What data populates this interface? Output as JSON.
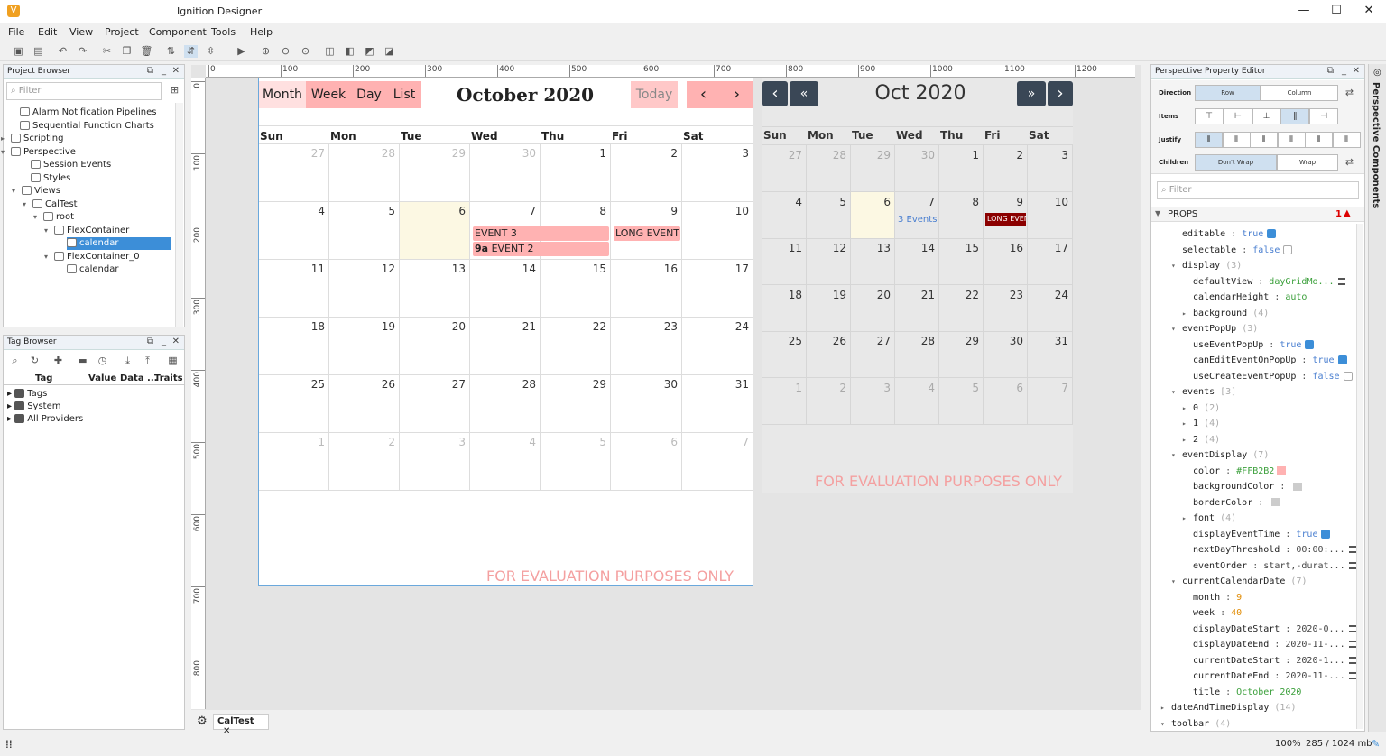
{
  "window": {
    "title": "Ignition Designer",
    "app_icon": "V",
    "minimize": "—",
    "maximize": "☐",
    "close": "✕"
  },
  "menu": [
    "File",
    "Edit",
    "View",
    "Project",
    "Component",
    "Tools",
    "Help"
  ],
  "project_browser": {
    "title": "Project Browser",
    "filter_placeholder": "Filter",
    "items": [
      {
        "label": "Alarm Notification Pipelines",
        "icon": "alarm-icon"
      },
      {
        "label": "Sequential Function Charts",
        "icon": "sfc-icon"
      },
      {
        "label": "Scripting",
        "icon": "script-icon"
      },
      {
        "label": "Perspective",
        "icon": "perspective-icon"
      },
      {
        "label": "Session Events",
        "icon": "session-icon"
      },
      {
        "label": "Styles",
        "icon": "styles-icon"
      },
      {
        "label": "Views",
        "icon": "views-icon"
      },
      {
        "label": "CalTest",
        "icon": "view-icon"
      },
      {
        "label": "root",
        "icon": "root-icon"
      },
      {
        "label": "FlexContainer",
        "icon": "flex-icon"
      },
      {
        "label": "calendar",
        "icon": "calendar-icon"
      },
      {
        "label": "FlexContainer_0",
        "icon": "flex-icon"
      },
      {
        "label": "calendar",
        "icon": "calendar-icon"
      }
    ]
  },
  "tag_browser": {
    "title": "Tag Browser",
    "columns": [
      "Tag",
      "Value",
      "Data ...",
      "Traits"
    ],
    "items": [
      "Tags",
      "System",
      "All Providers"
    ]
  },
  "ruler": {
    "h": [
      "0",
      "100",
      "200",
      "300",
      "400",
      "500",
      "600",
      "700",
      "800",
      "900",
      "1000",
      "1100",
      "1200"
    ],
    "v": [
      "0",
      "100",
      "200",
      "300",
      "400",
      "500",
      "600",
      "700",
      "800"
    ]
  },
  "calendar1": {
    "views": [
      "Month",
      "Week",
      "Day",
      "List"
    ],
    "title": "October 2020",
    "today": "Today",
    "prev": "‹",
    "next": "›",
    "dow": [
      "Sun",
      "Mon",
      "Tue",
      "Wed",
      "Thu",
      "Fri",
      "Sat"
    ],
    "days": [
      "27",
      "28",
      "29",
      "30",
      "1",
      "2",
      "3",
      "4",
      "5",
      "6",
      "7",
      "8",
      "9",
      "10",
      "11",
      "12",
      "13",
      "14",
      "15",
      "16",
      "17",
      "18",
      "19",
      "20",
      "21",
      "22",
      "23",
      "24",
      "25",
      "26",
      "27",
      "28",
      "29",
      "30",
      "31",
      "1",
      "2",
      "3",
      "4",
      "5",
      "6",
      "7"
    ],
    "events": {
      "event3": "EVENT 3",
      "event2_time": "9a",
      "event2": "EVENT 2",
      "long": "LONG EVENT N"
    },
    "watermark": "FOR EVALUATION PURPOSES ONLY",
    "event_color": "#FFB2B2"
  },
  "calendar2": {
    "prev": "‹",
    "prev_year": "«",
    "title": "Oct 2020",
    "next_year": "»",
    "next": "›",
    "dow": [
      "Sun",
      "Mon",
      "Tue",
      "Wed",
      "Thu",
      "Fri",
      "Sat"
    ],
    "days": [
      "27",
      "28",
      "29",
      "30",
      "1",
      "2",
      "3",
      "4",
      "5",
      "6",
      "7",
      "8",
      "9",
      "10",
      "11",
      "12",
      "13",
      "14",
      "15",
      "16",
      "17",
      "18",
      "19",
      "20",
      "21",
      "22",
      "23",
      "24",
      "25",
      "26",
      "27",
      "28",
      "29",
      "30",
      "31",
      "1",
      "2",
      "3",
      "4",
      "5",
      "6",
      "7"
    ],
    "events_link": "3 Events",
    "long_event": "LONG EVEN",
    "watermark": "FOR EVALUATION PURPOSES ONLY"
  },
  "editor_tab": {
    "label": "CalTest",
    "close": "✕"
  },
  "property_editor": {
    "title": "Perspective Property Editor",
    "direction_label": "Direction",
    "direction_options": [
      "Row",
      "Column"
    ],
    "items_label": "Items",
    "justify_label": "Justify",
    "children_label": "Children",
    "children_options": [
      "Don't Wrap",
      "Wrap"
    ],
    "filter_placeholder": "Filter",
    "props_header": "PROPS",
    "props_badge": "1",
    "rows": [
      {
        "k": "editable",
        "v": "true",
        "t": "bool",
        "ind": 1,
        "chk": true
      },
      {
        "k": "selectable",
        "v": "false",
        "t": "bool",
        "ind": 1,
        "chk": false
      },
      {
        "k": "display",
        "v": "(3)",
        "t": "cnt",
        "ind": 1,
        "exp": "open"
      },
      {
        "k": "defaultView",
        "v": "dayGridMo...",
        "t": "str",
        "ind": 2,
        "lines": true
      },
      {
        "k": "calendarHeight",
        "v": "auto",
        "t": "str",
        "ind": 2
      },
      {
        "k": "background",
        "v": "(4)",
        "t": "cnt",
        "ind": 2,
        "exp": "closed"
      },
      {
        "k": "eventPopUp",
        "v": "(3)",
        "t": "cnt",
        "ind": 1,
        "exp": "open"
      },
      {
        "k": "useEventPopUp",
        "v": "true",
        "t": "bool",
        "ind": 2,
        "chk": true
      },
      {
        "k": "canEditEventOnPopUp",
        "v": "true",
        "t": "bool",
        "ind": 2,
        "chk": true
      },
      {
        "k": "useCreateEventPopUp",
        "v": "false",
        "t": "bool",
        "ind": 2,
        "chk": false
      },
      {
        "k": "events",
        "v": "[3]",
        "t": "cnt",
        "ind": 1,
        "exp": "open"
      },
      {
        "k": "0",
        "v": "(2)",
        "t": "cnt",
        "ind": 2,
        "exp": "closed"
      },
      {
        "k": "1",
        "v": "(4)",
        "t": "cnt",
        "ind": 2,
        "exp": "closed"
      },
      {
        "k": "2",
        "v": "(4)",
        "t": "cnt",
        "ind": 2,
        "exp": "closed"
      },
      {
        "k": "eventDisplay",
        "v": "(7)",
        "t": "cnt",
        "ind": 1,
        "exp": "open"
      },
      {
        "k": "color",
        "v": "#FFB2B2",
        "t": "str",
        "ind": 2,
        "swatch": "#FFB2B2"
      },
      {
        "k": "backgroundColor",
        "v": "",
        "t": "str",
        "ind": 2,
        "swatch": "#cccccc"
      },
      {
        "k": "borderColor",
        "v": "",
        "t": "str",
        "ind": 2,
        "swatch": "#cccccc"
      },
      {
        "k": "font",
        "v": "(4)",
        "t": "cnt",
        "ind": 2,
        "exp": "closed"
      },
      {
        "k": "displayEventTime",
        "v": "true",
        "t": "bool",
        "ind": 2,
        "chk": true
      },
      {
        "k": "nextDayThreshold",
        "v": "00:00:...",
        "t": "plain",
        "ind": 2,
        "lines": true
      },
      {
        "k": "eventOrder",
        "v": "start,-durat...",
        "t": "plain",
        "ind": 2,
        "lines": true
      },
      {
        "k": "currentCalendarDate",
        "v": "(7)",
        "t": "cnt",
        "ind": 1,
        "exp": "open"
      },
      {
        "k": "month",
        "v": "9",
        "t": "num",
        "ind": 2
      },
      {
        "k": "week",
        "v": "40",
        "t": "num",
        "ind": 2
      },
      {
        "k": "displayDateStart",
        "v": "2020-0...",
        "t": "plain",
        "ind": 2,
        "lines": true
      },
      {
        "k": "displayDateEnd",
        "v": "2020-11-...",
        "t": "plain",
        "ind": 2,
        "lines": true
      },
      {
        "k": "currentDateStart",
        "v": "2020-1...",
        "t": "plain",
        "ind": 2,
        "lines": true
      },
      {
        "k": "currentDateEnd",
        "v": "2020-11-...",
        "t": "plain",
        "ind": 2,
        "lines": true
      },
      {
        "k": "title",
        "v": "October 2020",
        "t": "str",
        "ind": 2
      },
      {
        "k": "dateAndTimeDisplay",
        "v": "(14)",
        "t": "cnt",
        "ind": 0,
        "exp": "closed"
      },
      {
        "k": "toolbar",
        "v": "(4)",
        "t": "cnt",
        "ind": 0,
        "exp": "open"
      }
    ]
  },
  "side_strip": "Perspective Components",
  "status": {
    "zoom": "100%",
    "memory": "285 / 1024 mb"
  }
}
